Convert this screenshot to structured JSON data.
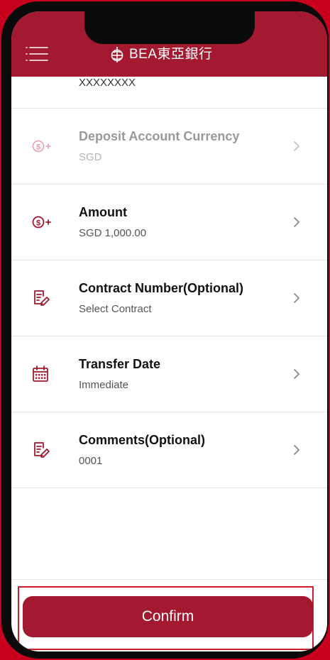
{
  "header": {
    "brand": "BEA東亞銀行",
    "menu_icon": "hamburger-menu-icon",
    "logo_icon": "bea-emblem-icon",
    "background_color": "#a3192f"
  },
  "list": {
    "partial_value": "XXXXXXXX",
    "rows": [
      {
        "title": "Deposit Account Currency",
        "value": "SGD",
        "icon": "dollar-plus-icon",
        "disabled": true
      },
      {
        "title": "Amount",
        "value": "SGD 1,000.00",
        "icon": "dollar-plus-icon",
        "disabled": false
      },
      {
        "title": "Contract Number(Optional)",
        "value": "Select Contract",
        "icon": "edit-document-icon",
        "disabled": false
      },
      {
        "title": "Transfer Date",
        "value": "Immediate",
        "icon": "calendar-icon",
        "disabled": false
      },
      {
        "title": "Comments(Optional)",
        "value": "0001",
        "icon": "edit-document-icon",
        "disabled": false
      }
    ]
  },
  "footer": {
    "confirm_label": "Confirm",
    "accent_color": "#a3192f"
  }
}
